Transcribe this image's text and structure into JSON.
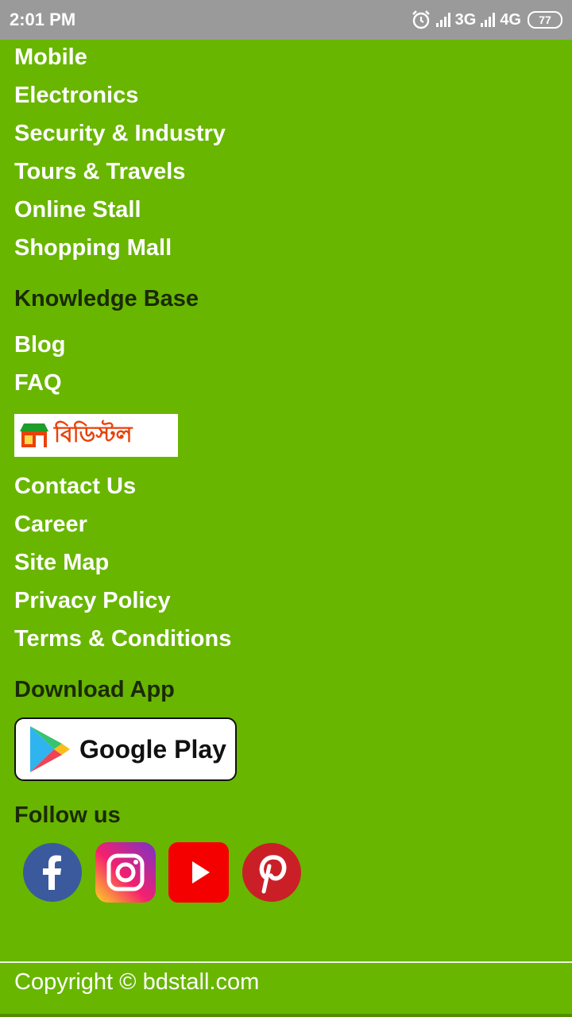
{
  "status_bar": {
    "time": "2:01 PM",
    "network_1": "3G",
    "network_2": "4G",
    "battery": "77"
  },
  "categories": [
    "Mobile",
    "Electronics",
    "Security & Industry",
    "Tours & Travels",
    "Online Stall",
    "Shopping Mall"
  ],
  "knowledge_base": {
    "heading": "Knowledge Base",
    "links": [
      "Blog",
      "FAQ"
    ]
  },
  "brand": {
    "logo_text": "বিডিস্টল"
  },
  "company_links": [
    "Contact Us",
    "Career",
    "Site Map",
    "Privacy Policy",
    "Terms & Conditions"
  ],
  "download": {
    "heading": "Download App",
    "store_label": "Google Play"
  },
  "follow": {
    "heading": "Follow us",
    "networks": [
      "facebook-icon",
      "instagram-icon",
      "youtube-icon",
      "pinterest-icon"
    ]
  },
  "footer": {
    "copyright": "Copyright © bdstall.com"
  },
  "colors": {
    "background": "#68b600",
    "status_bar": "#9a9a9a",
    "heading_text": "#1b2a06",
    "link_text": "#ffffff"
  }
}
